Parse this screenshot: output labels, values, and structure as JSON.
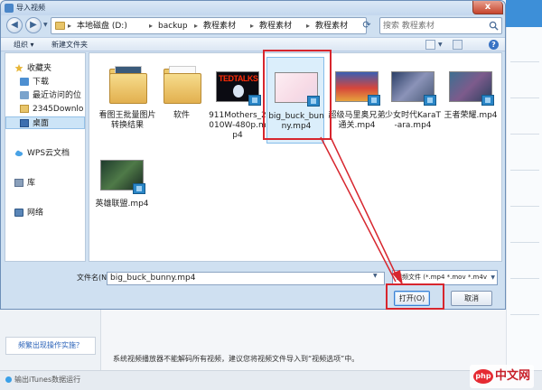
{
  "dialog": {
    "title": "导入视频",
    "close": "x"
  },
  "address": {
    "crumbs": [
      "本地磁盘 (D:)",
      "backup",
      "教程素材",
      "教程素材",
      "教程素材"
    ],
    "separator": "▸",
    "search_placeholder": "搜索 教程素材"
  },
  "toolbar": {
    "organize": "组织 ▾",
    "new_folder": "新建文件夹"
  },
  "nav": {
    "items": [
      {
        "label": "收藏夹"
      },
      {
        "label": "下载"
      },
      {
        "label": "最近访问的位"
      },
      {
        "label": "2345Downlo"
      },
      {
        "label": "桌面"
      },
      {
        "label": "WPS云文档"
      },
      {
        "label": "库"
      },
      {
        "label": "网络"
      }
    ]
  },
  "files": [
    {
      "name": "看图王批量图片转换结果"
    },
    {
      "name": "软件"
    },
    {
      "name": "911Mothers_2010W-480p.mp4",
      "badge": "TEDTALKS"
    },
    {
      "name": "big_buck_bunny.mp4"
    },
    {
      "name": "超级马里奥兄弟通关.mp4"
    },
    {
      "name": "少女时代KaraT-ara.mp4"
    },
    {
      "name": "王者荣耀.mp4"
    },
    {
      "name": "英雄联盟.mp4"
    }
  ],
  "footer": {
    "filename_label": "文件名(N):",
    "filename_value": "big_buck_bunny.mp4",
    "filter_value": "视频文件 (*.mp4 *.mov *.m4v",
    "open_button": "打开(O)",
    "cancel_button": "取消"
  },
  "background": {
    "help_link": "频繁出现操作实施？",
    "notice": "系统视频播放器不能解码所有视频，建议您将视频文件导入到“视频选项”中。",
    "itunes": "输出iTunes数据运行",
    "watermark_icon": "php",
    "watermark_text": "中文网"
  },
  "colors": {
    "highlight": "#d7262e",
    "selection": "#dbeefb"
  }
}
